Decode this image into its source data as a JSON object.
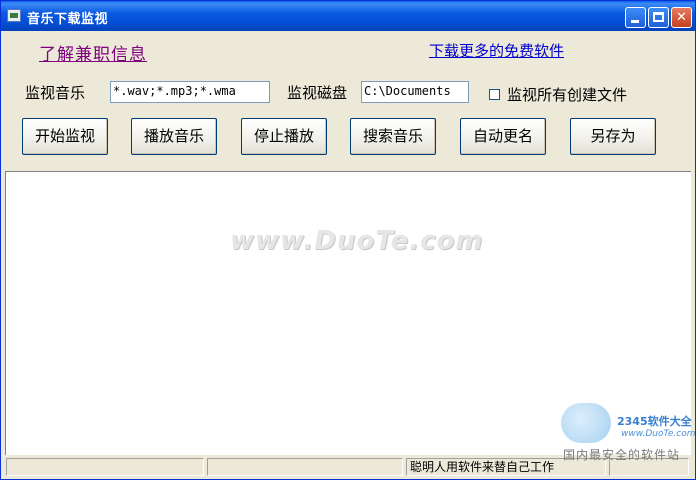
{
  "window": {
    "title": "音乐下载监视"
  },
  "links": {
    "part_time_info": "了解兼职信息",
    "more_software": "下载更多的免费软件"
  },
  "monitor": {
    "music_label": "监视音乐",
    "music_value": "*.wav;*.mp3;*.wma",
    "disk_label": "监视磁盘",
    "disk_value": "C:\\Documents",
    "all_files_label": "监视所有创建文件",
    "all_files_checked": false
  },
  "toolbar": {
    "start": "开始监视",
    "play": "播放音乐",
    "stop": "停止播放",
    "search": "搜索音乐",
    "rename": "自动更名",
    "save_as": "另存为"
  },
  "watermark": {
    "text": "www.DuoTe.com",
    "logo_text": "2345软件大全",
    "logo_url": "www.DuoTe.com",
    "site_name": "国内最安全的软件站"
  },
  "statusbar": {
    "cell1": "",
    "cell2": "",
    "cell3": "聪明人用软件来替自己工作",
    "cell4": ""
  },
  "colors": {
    "titlebar": "#0A5BE0",
    "link_visited": "#800080",
    "link": "#0000CC"
  }
}
